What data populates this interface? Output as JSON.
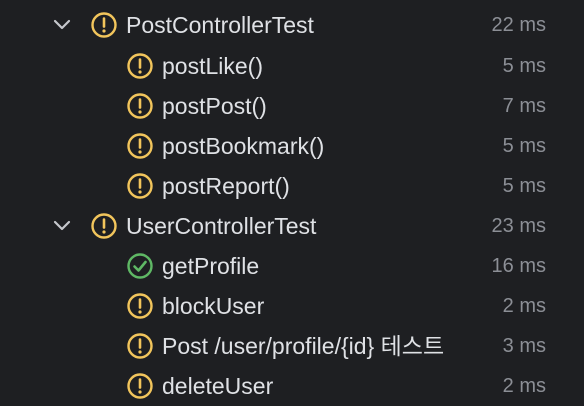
{
  "colors": {
    "background": "#1e1f22",
    "text": "#dfe1e5",
    "time": "#8c8f96",
    "warning": "#f2c55c",
    "passed": "#5fb865"
  },
  "groups": [
    {
      "name": "PostControllerTest",
      "time": "22 ms",
      "status_icon": "warning-icon",
      "expanded": true,
      "tests": [
        {
          "name": "postLike()",
          "time": "5 ms",
          "status_icon": "warning-icon"
        },
        {
          "name": "postPost()",
          "time": "7 ms",
          "status_icon": "warning-icon"
        },
        {
          "name": "postBookmark()",
          "time": "5 ms",
          "status_icon": "warning-icon"
        },
        {
          "name": "postReport()",
          "time": "5 ms",
          "status_icon": "warning-icon"
        }
      ]
    },
    {
      "name": "UserControllerTest",
      "time": "23 ms",
      "status_icon": "warning-icon",
      "expanded": true,
      "tests": [
        {
          "name": "getProfile",
          "time": "16 ms",
          "status_icon": "check-circle-icon"
        },
        {
          "name": "blockUser",
          "time": "2 ms",
          "status_icon": "warning-icon"
        },
        {
          "name": "Post /user/profile/{id} 테스트",
          "time": "3 ms",
          "status_icon": "warning-icon"
        },
        {
          "name": "deleteUser",
          "time": "2 ms",
          "status_icon": "warning-icon"
        }
      ]
    }
  ]
}
